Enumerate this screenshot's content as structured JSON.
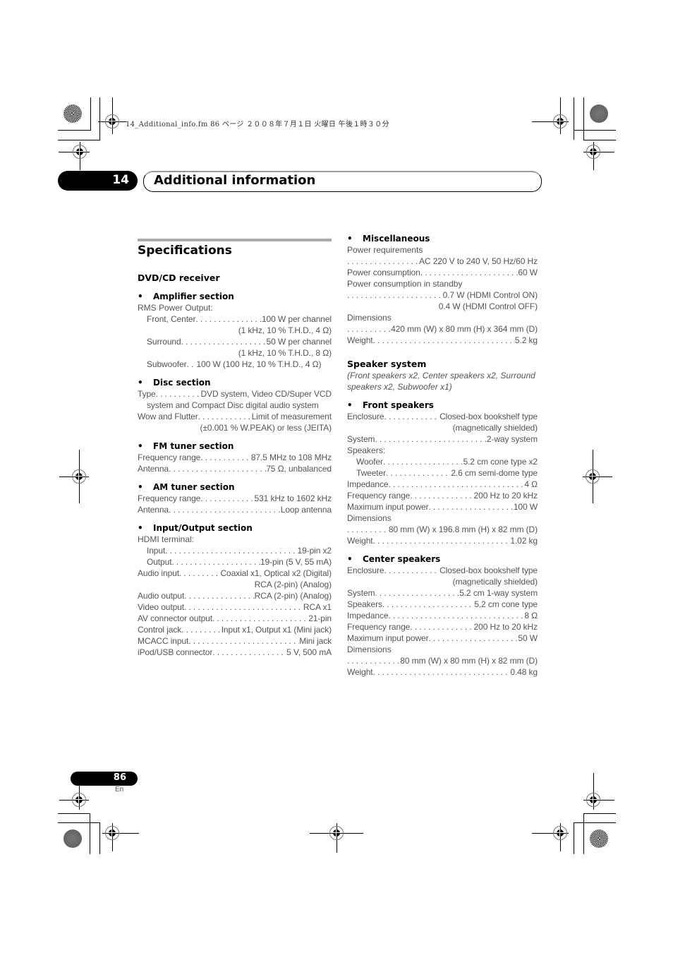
{
  "print_header": "14_Additional_info.fm  86 ページ  ２００８年７月１日  火曜日  午後１時３０分",
  "chapter": {
    "number": "14",
    "title": "Additional information"
  },
  "page": {
    "number": "86",
    "lang": "En"
  },
  "specs": {
    "title": "Specifications",
    "receiver": {
      "heading": "DVD/CD receiver",
      "amplifier": {
        "heading": "Amplifier section",
        "rms_label": "RMS Power Output:",
        "front_label": "Front, Center",
        "front_value": "100 W per channel",
        "front_note": "(1 kHz, 10 % T.H.D., 4 Ω)",
        "surround_label": "Surround",
        "surround_value": "50 W per channel",
        "surround_note": "(1 kHz, 10 % T.H.D., 8 Ω)",
        "sub_label": "Subwoofer",
        "sub_value": "100 W (100 Hz, 10 % T.H.D., 4 Ω)"
      },
      "disc": {
        "heading": "Disc section",
        "type_label": "Type",
        "type_value": "DVD system, Video CD/Super VCD",
        "type_cont": "system and Compact Disc digital audio system",
        "wow_label": "Wow and Flutter",
        "wow_value": "Limit of measurement",
        "wow_cont": "(±0.001 % W.PEAK) or less (JEITA)"
      },
      "fm": {
        "heading": "FM tuner section",
        "freq_label": "Frequency range",
        "freq_value": "87.5 MHz to 108 MHz",
        "ant_label": "Antenna",
        "ant_value": "75 Ω, unbalanced"
      },
      "am": {
        "heading": "AM tuner section",
        "freq_label": "Frequency range",
        "freq_value": "531 kHz to 1602 kHz",
        "ant_label": "Antenna",
        "ant_value": "Loop antenna"
      },
      "io": {
        "heading": "Input/Output section",
        "hdmi_label": "HDMI terminal:",
        "hdmi_in_label": "Input",
        "hdmi_in_value": "19-pin x2",
        "hdmi_out_label": "Output",
        "hdmi_out_value": "19-pin (5 V, 55 mA)",
        "ain_label": "Audio input",
        "ain_value": "Coaxial x1, Optical x2 (Digital)",
        "ain_cont": "RCA (2-pin) (Analog)",
        "aout_label": "Audio output",
        "aout_value": "RCA (2-pin) (Analog)",
        "vout_label": "Video output",
        "vout_value": "RCA x1",
        "av_label": "AV connector output",
        "av_value": "21-pin",
        "ctrl_label": "Control jack",
        "ctrl_value": "Input x1, Output x1 (Mini jack)",
        "mcacc_label": "MCACC input",
        "mcacc_value": "Mini jack",
        "ipod_label": "iPod/USB connector",
        "ipod_value": "5 V, 500 mA"
      },
      "misc": {
        "heading": "Miscellaneous",
        "power_req_label": "Power requirements",
        "power_req_value": "AC 220 V to 240 V, 50 Hz/60 Hz",
        "power_cons_label": "Power consumption",
        "power_cons_value": "60 W",
        "standby_label": "Power consumption in standby",
        "standby_on": "0.7 W (HDMI Control ON)",
        "standby_off": "0.4 W (HDMI Control OFF)",
        "dim_label": "Dimensions",
        "dim_value": "420 mm (W) x 80 mm (H) x 364 mm (D)",
        "weight_label": "Weight",
        "weight_value": "5.2 kg"
      }
    },
    "speakers": {
      "heading": "Speaker system",
      "subtitle": "(Front speakers x2, Center speakers x2, Surround speakers x2, Subwoofer x1)",
      "front": {
        "heading": "Front speakers",
        "encl_label": "Enclosure",
        "encl_value": "Closed-box bookshelf type",
        "encl_cont": "(magnetically shielded)",
        "sys_label": "System",
        "sys_value": "2-way system",
        "spk_label": "Speakers:",
        "woofer_label": "Woofer",
        "woofer_value": "5.2 cm cone type x2",
        "tweeter_label": "Tweeter",
        "tweeter_value": "2.6 cm semi-dome type",
        "imp_label": "Impedance",
        "imp_value": "4 Ω",
        "freq_label": "Frequency range",
        "freq_value": "200 Hz to 20 kHz",
        "maxp_label": "Maximum input power",
        "maxp_value": "100 W",
        "dim_label": "Dimensions",
        "dim_value": "80 mm (W) x 196.8 mm (H) x 82 mm (D)",
        "weight_label": "Weight",
        "weight_value": "1.02 kg"
      },
      "center": {
        "heading": "Center speakers",
        "encl_label": "Enclosure",
        "encl_value": "Closed-box bookshelf type",
        "encl_cont": "(magnetically shielded)",
        "sys_label": "System",
        "sys_value": "5.2 cm 1-way system",
        "spk_label": "Speakers",
        "spk_value": "5.2 cm cone type",
        "imp_label": "Impedance",
        "imp_value": "8 Ω",
        "freq_label": "Frequency range",
        "freq_value": "200 Hz to 20 kHz",
        "maxp_label": "Maximum input power",
        "maxp_value": "50 W",
        "dim_label": "Dimensions",
        "dim_value": "80 mm (W) x 80 mm (H) x 82 mm (D)",
        "weight_label": "Weight",
        "weight_value": "0.48 kg"
      }
    }
  }
}
